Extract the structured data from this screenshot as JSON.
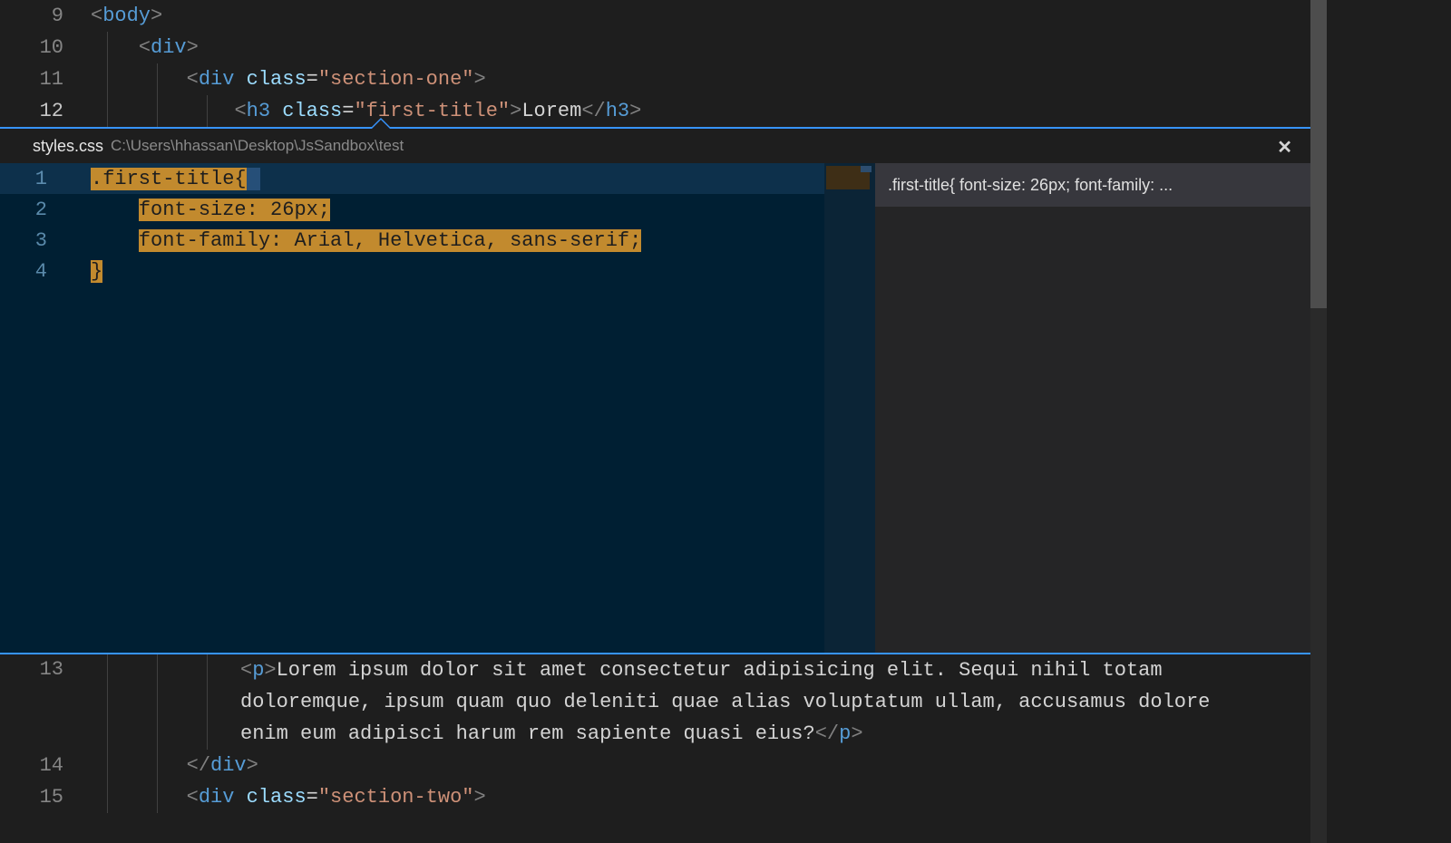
{
  "editor_top": {
    "lines": [
      {
        "num": "9",
        "indent": 1,
        "tokens": [
          [
            "br",
            "<"
          ],
          [
            "tag",
            "body"
          ],
          [
            "br",
            ">"
          ]
        ]
      },
      {
        "num": "10",
        "indent": 2,
        "tokens": [
          [
            "br",
            "<"
          ],
          [
            "tag",
            "div"
          ],
          [
            "br",
            ">"
          ]
        ]
      },
      {
        "num": "11",
        "indent": 3,
        "tokens": [
          [
            "br",
            "<"
          ],
          [
            "tag",
            "div"
          ],
          [
            "txt",
            " "
          ],
          [
            "attrn",
            "class"
          ],
          [
            "txt",
            "="
          ],
          [
            "attrv",
            "\"section-one\""
          ],
          [
            "br",
            ">"
          ]
        ]
      },
      {
        "num": "12",
        "indent": 4,
        "active": true,
        "tokens": [
          [
            "br",
            "<"
          ],
          [
            "tag",
            "h3"
          ],
          [
            "txt",
            " "
          ],
          [
            "attrn",
            "class"
          ],
          [
            "txt",
            "="
          ],
          [
            "attrv",
            "\"first-title\""
          ],
          [
            "br",
            ">"
          ],
          [
            "txt",
            "Lorem"
          ],
          [
            "br",
            "</"
          ],
          [
            "tag",
            "h3"
          ],
          [
            "br",
            ">"
          ]
        ]
      }
    ]
  },
  "peek": {
    "file_name": "styles.css",
    "file_path": "C:\\Users\\hhassan\\Desktop\\JsSandbox\\test",
    "close_glyph": "✕",
    "result_text": ".first-title{ font-size: 26px; font-family: ...",
    "css_lines": [
      {
        "num": "1",
        "raw": ".first-title{",
        "hl_full": true,
        "sel_tail": true
      },
      {
        "num": "2",
        "raw_tokens": [
          [
            "txt",
            "    "
          ],
          [
            "hl_start",
            ""
          ],
          [
            "prop",
            "font-size"
          ],
          [
            "punct",
            ":"
          ],
          [
            "txt",
            " "
          ],
          [
            "num",
            "26px"
          ],
          [
            "punct",
            ";"
          ],
          [
            "hl_end",
            ""
          ]
        ]
      },
      {
        "num": "3",
        "raw_tokens": [
          [
            "txt",
            "    "
          ],
          [
            "hl_start",
            ""
          ],
          [
            "prop",
            "font-family"
          ],
          [
            "punct",
            ":"
          ],
          [
            "txt",
            " "
          ],
          [
            "cval",
            "Arial"
          ],
          [
            "punct",
            ","
          ],
          [
            "txt",
            " "
          ],
          [
            "cval",
            "Helvetica"
          ],
          [
            "punct",
            ","
          ],
          [
            "txt",
            " "
          ],
          [
            "cval",
            "sans-serif"
          ],
          [
            "punct",
            ";"
          ],
          [
            "hl_end",
            ""
          ]
        ]
      },
      {
        "num": "4",
        "raw": "}",
        "hl_full": true
      }
    ]
  },
  "editor_bottom": {
    "lines": [
      {
        "num": "13",
        "indent": 4,
        "wrap": true,
        "first": [
          [
            "br",
            "<"
          ],
          [
            "tag",
            "p"
          ],
          [
            "br",
            ">"
          ],
          [
            "txt",
            "Lorem ipsum dolor sit amet consectetur adipisicing elit. Sequi nihil totam "
          ]
        ],
        "rest": [
          "doloremque, ipsum quam quo deleniti quae alias voluptatum ullam, accusamus dolore ",
          "enim eum adipisci harum rem sapiente quasi eius?"
        ],
        "close": [
          [
            "br",
            "</"
          ],
          [
            "tag",
            "p"
          ],
          [
            "br",
            ">"
          ]
        ]
      },
      {
        "num": "14",
        "indent": 3,
        "tokens": [
          [
            "br",
            "</"
          ],
          [
            "tag",
            "div"
          ],
          [
            "br",
            ">"
          ]
        ]
      },
      {
        "num": "15",
        "indent": 3,
        "tokens": [
          [
            "br",
            "<"
          ],
          [
            "tag",
            "div"
          ],
          [
            "txt",
            " "
          ],
          [
            "attrn",
            "class"
          ],
          [
            "txt",
            "="
          ],
          [
            "attrv",
            "\"section-two\""
          ],
          [
            "br",
            ">"
          ]
        ]
      }
    ]
  }
}
